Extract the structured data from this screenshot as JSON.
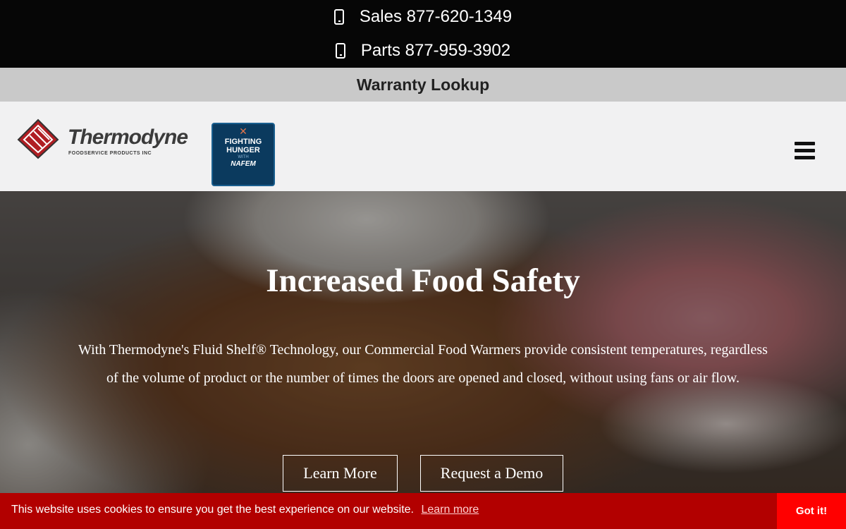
{
  "topbar": {
    "sales_phone": "Sales 877-620-1349",
    "parts_phone": "Parts 877-959-3902",
    "phone_icon": "mobile-phone-icon"
  },
  "warranty": {
    "label": "Warranty Lookup"
  },
  "header": {
    "logo_text": "Thermodyne",
    "logo_subtext": "FOODSERVICE PRODUCTS INC",
    "badge": {
      "line1": "FIGHTING",
      "line2": "HUNGER",
      "with": "WITH",
      "org": "NAFEM"
    },
    "menu_icon": "hamburger-menu-icon"
  },
  "hero": {
    "title": "Increased Food Safety",
    "text": "With Thermodyne's Fluid Shelf® Technology, our Commercial Food Warmers provide consistent temperatures, regardless of the volume of product or the number of times the doors are opened and closed, without using fans or air flow.",
    "learn_more": "Learn More",
    "request_demo": "Request a Demo"
  },
  "cookie": {
    "message": "This website uses cookies to ensure you get the best experience on our website.",
    "link": "Learn more",
    "button": "Got it!"
  },
  "colors": {
    "topbar_bg": "#060606",
    "warranty_bg": "#c9c9c9",
    "header_bg": "#f1f1f2",
    "cookie_bg": "#b20000",
    "cookie_button_bg": "#ff0000",
    "logo_red": "#b01e23",
    "badge_bg": "#0b3a5e"
  }
}
